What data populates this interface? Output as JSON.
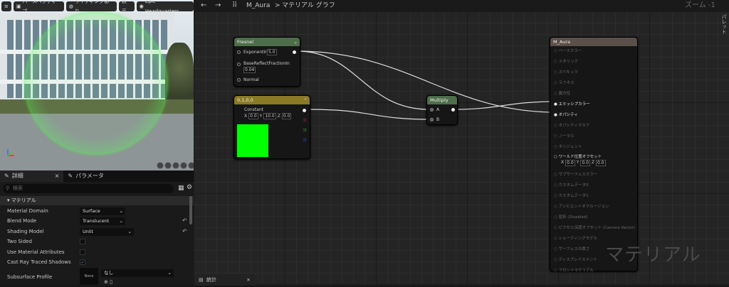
{
  "viewport": {
    "buttons": [
      "パースペクティブ",
      "ライティングあり",
      "表示",
      "Epic Headquarters"
    ]
  },
  "details": {
    "tabs": [
      {
        "label": "詳細"
      },
      {
        "label": "パラメータ"
      }
    ],
    "search_placeholder": "検索",
    "section_title": "マテリアル",
    "rows": [
      {
        "label": "Material Domain",
        "value": "Surface"
      },
      {
        "label": "Blend Mode",
        "value": "Translucent"
      },
      {
        "label": "Shading Model",
        "value": "Unlit"
      },
      {
        "label": "Two Sided",
        "value": ""
      },
      {
        "label": "Use Material Attributes",
        "value": ""
      },
      {
        "label": "Cast Ray Traced Shadows",
        "value": "✓"
      },
      {
        "label": "Subsurface Profile",
        "value": "なし"
      }
    ],
    "subsurface_thumb": "None"
  },
  "graph": {
    "breadcrumb_asset": "M_Aura",
    "breadcrumb_page": "マテリアル グラフ",
    "zoom": "ズーム -1",
    "side_tab": "パレット",
    "watermark": "マテリアル",
    "stats_tab": "統計",
    "fresnel": {
      "title": "Fresnel",
      "exponent_label": "ExponentIn",
      "exponent_value": "5.0",
      "base_label": "BaseReflectFractionIn",
      "base_value": "0.04",
      "normal_label": "Normal"
    },
    "constant": {
      "title": "0,1,0,0",
      "label": "Constant",
      "x": "0.0",
      "y": "10.0",
      "z": "0.0",
      "x_label": "X",
      "y_label": "Y",
      "z_label": "Z",
      "color": "#00ff00"
    },
    "multiply": {
      "title": "Multiply",
      "a": "A",
      "b": "B"
    },
    "output": {
      "title": "M_Aura",
      "pins": [
        "ベースカラー",
        "メタリック",
        "スペキュラ",
        "ラフネス",
        "異方性",
        "エミッシブカラー",
        "オパシティ",
        "オパシティマスク",
        "ノーマル",
        "タンジェント",
        "ワールド位置オフセット",
        "サブサーフェスカラー",
        "カスタムデータ0",
        "カスタムデータ1",
        "アンビエントオクルージョン",
        "屈折 (Disabled)",
        "ピクセル深度オフセット (Camera Vector)",
        "シェーディングモデル",
        "サーフェスの厚さ",
        "ディスプレイスメント",
        "フロントマテリアル"
      ],
      "wpo_x": "0.0",
      "wpo_y": "0.0",
      "wpo_z": "0.0"
    }
  },
  "colors": {
    "fresnel_header": "#4e6d4a",
    "constant_header": "#8a7a25",
    "multiply_header": "#4e6d4a",
    "output_header": "#5a4f49"
  }
}
